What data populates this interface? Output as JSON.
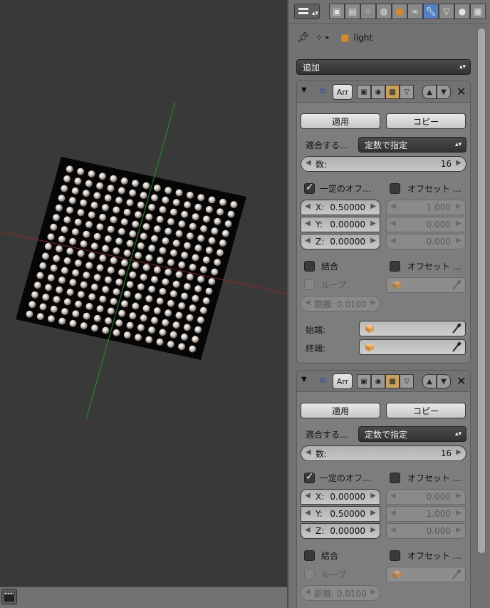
{
  "viewport": {
    "grid_columns": 16,
    "grid_rows": 16,
    "axis_colors": {
      "x_axis": "#8a2a2a",
      "y_axis": "#2f8a2f"
    },
    "sphere_color": "#d8d0c8"
  },
  "header": {
    "editor_icon": "editor-type-icon",
    "tabs": [
      "render-icon",
      "render-layers-icon",
      "scene-icon",
      "world-icon",
      "object-icon",
      "constraints-icon",
      "modifier-icon",
      "data-icon",
      "material-icon",
      "texture-icon"
    ]
  },
  "breadcrumb": {
    "object_name": "light"
  },
  "add_modifier": {
    "label": "追加"
  },
  "modifiers": [
    {
      "name": "Arr",
      "apply_label": "適用",
      "copy_label": "コピー",
      "fit_label": "適合する…",
      "fit_value": "定数で指定",
      "count_label": "数:",
      "count_value": "16",
      "relative_offset_label": "一定のオフ…",
      "relative_checked": true,
      "offset_x_label": "X:",
      "offset_x": "0.50000",
      "offset_y_label": "Y:",
      "offset_y": "0.00000",
      "offset_z_label": "Z:",
      "offset_z": "0.00000",
      "constant_offset_label": "オフセット …",
      "constant_x": "1.000",
      "constant_y": "0.000",
      "constant_z": "0.000",
      "merge_label": "結合",
      "object_offset_label": "オフセット …",
      "loop_label": "ループ",
      "distance_label": "距離: 0.0100",
      "start_label": "始端:",
      "end_label": "終端:"
    },
    {
      "name": "Arr",
      "apply_label": "適用",
      "copy_label": "コピー",
      "fit_label": "適合する…",
      "fit_value": "定数で指定",
      "count_label": "数:",
      "count_value": "16",
      "relative_offset_label": "一定のオフ…",
      "relative_checked": true,
      "offset_x_label": "X:",
      "offset_x": "0.00000",
      "offset_y_label": "Y:",
      "offset_y": "0.50000",
      "offset_z_label": "Z:",
      "offset_z": "0.00000",
      "constant_offset_label": "オフセット …",
      "constant_x": "0.000",
      "constant_y": "1.000",
      "constant_z": "0.000",
      "merge_label": "結合",
      "object_offset_label": "オフセット …",
      "loop_label": "ループ",
      "distance_label": "距離: 0.0100"
    }
  ]
}
